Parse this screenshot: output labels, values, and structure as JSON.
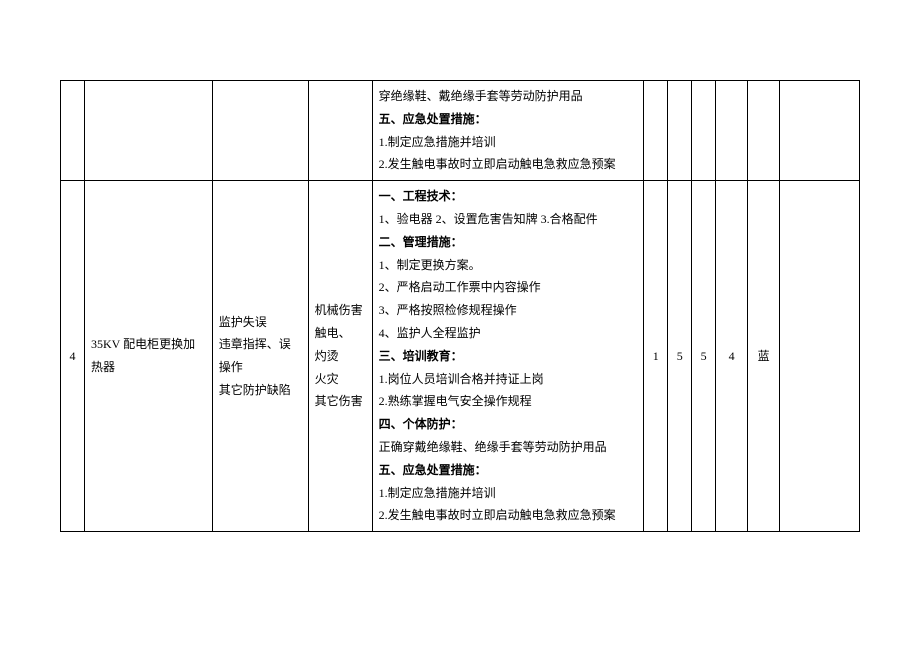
{
  "rows": [
    {
      "num": "",
      "task": "",
      "cause": "",
      "hazard": "",
      "measures": [
        {
          "text": "穿绝缘鞋、戴绝缘手套等劳动防护用品",
          "bold": false
        },
        {
          "text": "五、应急处置措施：",
          "bold": true
        },
        {
          "text": "1.制定应急措施并培训",
          "bold": false
        },
        {
          "text": "2.发生触电事故时立即启动触电急救应急预案",
          "bold": false
        }
      ],
      "s1": "",
      "s2": "",
      "s3": "",
      "s4": "",
      "lvl": "",
      "ext": ""
    },
    {
      "num": "4",
      "task": "35KV 配电柜更换加热器",
      "cause": "监护失误\n违章指挥、误操作\n其它防护缺陷",
      "hazard": "机械伤害\n触电、\n灼烫\n火灾\n其它伤害",
      "measures": [
        {
          "text": "一、工程技术：",
          "bold": true
        },
        {
          "text": "1、验电器 2、设置危害告知牌 3.合格配件",
          "bold": false
        },
        {
          "text": "二、管理措施：",
          "bold": true
        },
        {
          "text": "1、制定更换方案。",
          "bold": false
        },
        {
          "text": "2、严格启动工作票中内容操作",
          "bold": false
        },
        {
          "text": "3、严格按照检修规程操作",
          "bold": false
        },
        {
          "text": "4、监护人全程监护",
          "bold": false
        },
        {
          "text": "三、培训教育：",
          "bold": true
        },
        {
          "text": "1.岗位人员培训合格并持证上岗",
          "bold": false
        },
        {
          "text": "2.熟练掌握电气安全操作规程",
          "bold": false
        },
        {
          "text": "四、个体防护：",
          "bold": true
        },
        {
          "text": "正确穿戴绝缘鞋、绝缘手套等劳动防护用品",
          "bold": false
        },
        {
          "text": "五、应急处置措施：",
          "bold": true
        },
        {
          "text": "1.制定应急措施并培训",
          "bold": false
        },
        {
          "text": "2.发生触电事故时立即启动触电急救应急预案",
          "bold": false
        }
      ],
      "s1": "1",
      "s2": "5",
      "s3": "5",
      "s4": "4",
      "lvl": "蓝",
      "ext": ""
    }
  ]
}
